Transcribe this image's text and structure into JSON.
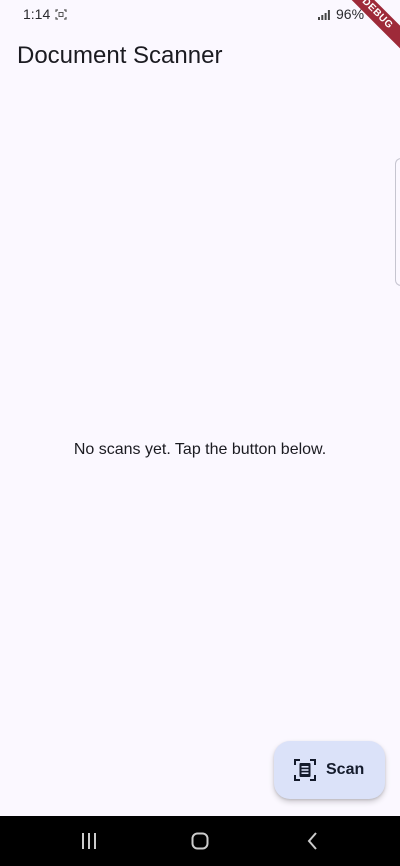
{
  "status_bar": {
    "time": "1:14",
    "battery": "96%"
  },
  "debug_banner": "DEBUG",
  "app_bar": {
    "title": "Document Scanner"
  },
  "main": {
    "empty_message": "No scans yet. Tap the button below."
  },
  "fab": {
    "label": "Scan",
    "icon": "document-scanner-icon"
  },
  "nav_bar": {
    "icons": [
      "recent-apps-icon",
      "home-icon",
      "back-icon"
    ]
  },
  "colors": {
    "background": "#fbf8ff",
    "fab_background": "#dbe2f9",
    "debug_banner": "#9e2a39",
    "nav_bar": "#000000"
  }
}
